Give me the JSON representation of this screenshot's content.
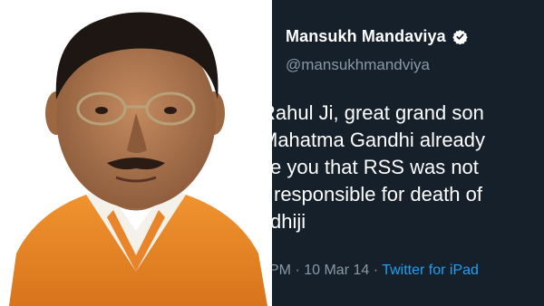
{
  "tweet": {
    "display_name": "Mansukh Mandaviya",
    "handle": "@mansukhmandviya",
    "lines": [
      "Rahul Ji, great grand son",
      "Mahatma Gandhi already",
      "e you that RSS was not",
      "responsible for death of",
      "dhiji"
    ],
    "time_fragment": "PM",
    "separator": "·",
    "date": "10 Mar 14",
    "source": "Twitter for iPad"
  },
  "colors": {
    "tweet_background": "#15202b",
    "text_primary": "#ffffff",
    "text_secondary": "#8899a6",
    "link_blue": "#1da1f2",
    "jacket_orange": "#e8852a"
  },
  "icons": {
    "verified": "verified-badge-icon"
  }
}
